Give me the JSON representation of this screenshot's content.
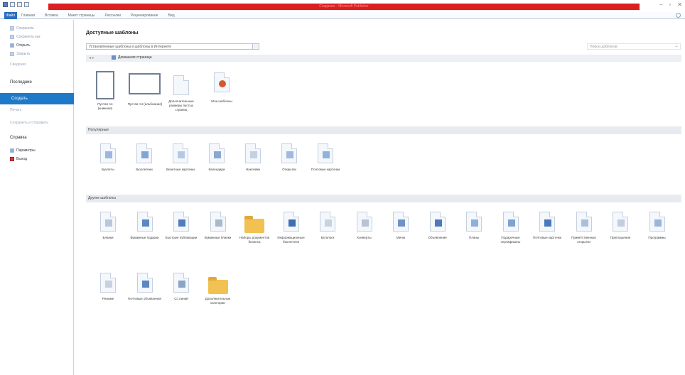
{
  "app": {
    "title": "Создание - Microsoft Publisher",
    "window_controls": [
      "–",
      "▫",
      "✕"
    ]
  },
  "ribbon": {
    "file_tab": "Файл",
    "tabs": [
      "Главная",
      "Вставка",
      "Макет страницы",
      "Рассылки",
      "Рецензирование",
      "Вид"
    ]
  },
  "sidebar": {
    "top_items": [
      "Сохранить",
      "Сохранить как",
      "Открыть",
      "Закрыть"
    ],
    "info": "Сведения",
    "recent": "Последние",
    "selected": "Создать",
    "print": "Печать",
    "save_send": "Сохранить и отправить",
    "help": "Справка",
    "options": "Параметры",
    "exit": "Выход"
  },
  "main": {
    "heading": "Доступные шаблоны",
    "combo_value": "Установленные шаблоны и шаблоны в Интернете",
    "search_placeholder": "Поиск шаблонов",
    "home_label": "Домашняя страница",
    "section_popular": "Популярные",
    "section_more": "Другие шаблоны",
    "top_tiles": [
      {
        "label": "Пустая А4 (книжная)",
        "kind": "portrait"
      },
      {
        "label": "Пустая А4 (альбомная)",
        "kind": "landscape"
      },
      {
        "label": "Дополнительные размеры пустых страниц",
        "kind": "doc"
      },
      {
        "label": "Мои шаблоны",
        "kind": "doc-person"
      }
    ],
    "popular_tiles": [
      "Буклеты",
      "Бюллетени",
      "Визитные карточки",
      "Календари",
      "Наклейки",
      "Открытки",
      "Почтовые карточки"
    ],
    "more_tiles": [
      "Бланки",
      "Бумажные подарки",
      "Быстрые публикации",
      "Бумажные бланки",
      "Наборы документов бизнеса",
      "Информационные бюллетени",
      "Каталоги",
      "Конверты",
      "Меню",
      "Объявления",
      "Планы",
      "Подарочные сертификаты",
      "Почтовые карточки",
      "Приветственные открытки",
      "Приглашения",
      "Программы",
      "Резюме",
      "Почтовые объявления",
      "Сс.линий",
      "Дополнительные категории"
    ]
  },
  "colors": {
    "title_band": "#dd1f1f",
    "accent": "#1f79c9",
    "section_bg": "#e7ebf0"
  }
}
